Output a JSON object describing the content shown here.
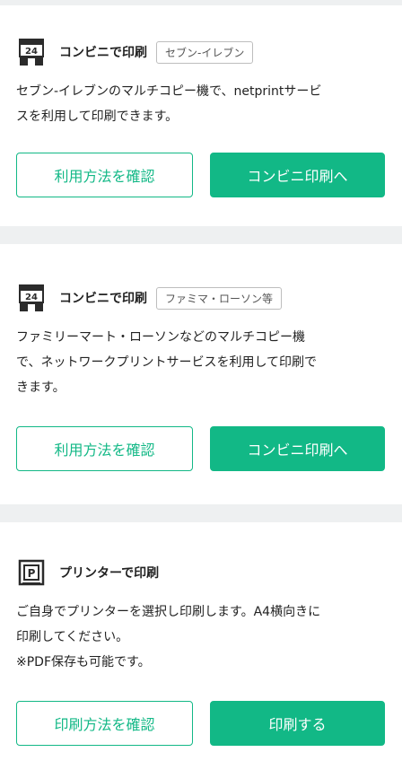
{
  "cards": [
    {
      "title": "コンビニで印刷",
      "tag": "セブン-イレブン",
      "icon": "convenience-store-24-icon",
      "desc": [
        "セブン-イレブンのマルチコピー機で、netprintサービ",
        "スを利用して印刷できます。"
      ],
      "secondary_label": "利用方法を確認",
      "primary_label": "コンビニ印刷へ"
    },
    {
      "title": "コンビニで印刷",
      "tag": "ファミマ・ローソン等",
      "icon": "convenience-store-24-icon",
      "desc": [
        "ファミリーマート・ローソンなどのマルチコピー機",
        "で、ネットワークプリントサービスを利用して印刷で",
        "きます。"
      ],
      "secondary_label": "利用方法を確認",
      "primary_label": "コンビニ印刷へ"
    },
    {
      "title": "プリンターで印刷",
      "icon": "printer-icon",
      "desc": [
        "ご自身でプリンターを選択し印刷します。A4横向きに",
        "印刷してください。",
        "※PDF保存も可能です。"
      ],
      "secondary_label": "印刷方法を確認",
      "primary_label": "印刷する"
    }
  ],
  "colors": {
    "accent": "#12b886",
    "background": "#eef0f1",
    "card": "#ffffff"
  }
}
